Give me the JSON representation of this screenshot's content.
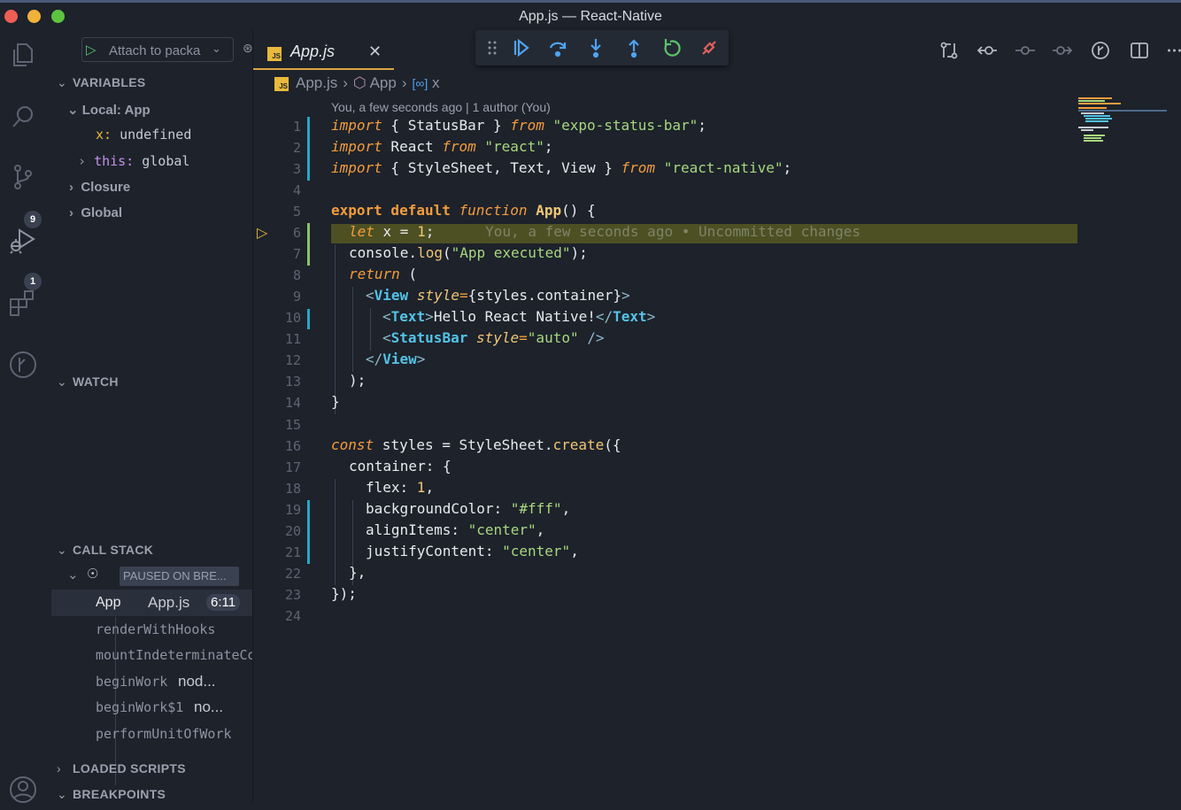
{
  "window": {
    "title": "App.js — React-Native",
    "controls": {
      "close_color": "#ee5e55",
      "minimize_color": "#f1b23a",
      "maximize_color": "#5dc440"
    }
  },
  "activity_bar": {
    "items": [
      {
        "icon": "files-icon"
      },
      {
        "icon": "search-icon"
      },
      {
        "icon": "source-control-icon",
        "badge": "9"
      },
      {
        "icon": "run-debug-icon",
        "badge": "1"
      },
      {
        "icon": "extensions-icon"
      },
      {
        "icon": "timeline-icon"
      },
      {
        "icon": "account-icon"
      }
    ]
  },
  "sidebar": {
    "debug_config": "Attach to packa",
    "variables": {
      "title": "VARIABLES",
      "local": "Local: App",
      "x_name": "x:",
      "x_value": "undefined",
      "this_name": "this:",
      "this_value": "global",
      "closure": "Closure",
      "global": "Global"
    },
    "watch": {
      "title": "WATCH"
    },
    "call_stack": {
      "title": "CALL STACK",
      "paused_label": "PAUSED ON BRE...",
      "frames": [
        {
          "fn": "App",
          "file": "App.js",
          "line": "6:11"
        },
        {
          "fn": "renderWithHooks",
          "file": ""
        },
        {
          "fn": "mountIndeterminateCo",
          "file": ""
        },
        {
          "fn": "beginWork",
          "file": "nod..."
        },
        {
          "fn": "beginWork$1",
          "file": "no..."
        },
        {
          "fn": "performUnitOfWork",
          "file": ""
        }
      ]
    },
    "loaded_scripts": "LOADED SCRIPTS",
    "breakpoints": "BREAKPOINTS"
  },
  "editor": {
    "tab": {
      "label": "App.js",
      "icon_text": "JS"
    },
    "breadcrumb": {
      "file": "App.js",
      "symbol": "App",
      "variable": "x"
    },
    "blame": "You, a few seconds ago | 1 author (You)",
    "inline_blame": "You, a few seconds ago • Uncommitted changes",
    "line_numbers": [
      "1",
      "2",
      "3",
      "4",
      "5",
      "6",
      "7",
      "8",
      "9",
      "10",
      "11",
      "12",
      "13",
      "14",
      "15",
      "16",
      "17",
      "18",
      "19",
      "20",
      "21",
      "22",
      "23",
      "24"
    ],
    "code": {
      "l1": [
        "import",
        " { StatusBar } ",
        "from",
        " ",
        "\"expo-status-bar\"",
        ";"
      ],
      "l2": [
        "import",
        " React ",
        "from",
        " ",
        "\"react\"",
        ";"
      ],
      "l3": [
        "import",
        " { StyleSheet, Text, View } ",
        "from",
        " ",
        "\"react-native\"",
        ";"
      ],
      "l5": [
        "export default",
        " ",
        "function",
        " ",
        "App",
        "() {"
      ],
      "l6": [
        "let",
        " x = ",
        "1",
        ";"
      ],
      "l7": [
        "console.",
        "log",
        "(",
        "\"App executed\"",
        ");"
      ],
      "l8": [
        "return",
        " ("
      ],
      "l9": [
        "<",
        "View",
        " ",
        "style",
        "=",
        "{styles.container}",
        ">"
      ],
      "l10": [
        "<",
        "Text",
        ">",
        "Hello React Native!",
        "</",
        "Text",
        ">"
      ],
      "l11": [
        "<",
        "StatusBar",
        " ",
        "style",
        "=",
        "\"auto\"",
        " />"
      ],
      "l12": [
        "</",
        "View",
        ">"
      ],
      "l13": [
        ");"
      ],
      "l14": [
        "}"
      ],
      "l16": [
        "const",
        " styles = StyleSheet.",
        "create",
        "({"
      ],
      "l17": [
        "container: {"
      ],
      "l18": [
        "flex: ",
        "1",
        ","
      ],
      "l19": [
        "backgroundColor: ",
        "\"#fff\"",
        ","
      ],
      "l20": [
        "alignItems: ",
        "\"center\"",
        ","
      ],
      "l21": [
        "justifyContent: ",
        "\"center\"",
        ","
      ],
      "l22": [
        "},"
      ],
      "l23": [
        "});"
      ]
    }
  },
  "debug_toolbar": {
    "buttons": [
      "drag-handle-icon",
      "continue-icon",
      "step-over-icon",
      "step-into-icon",
      "step-out-icon",
      "restart-icon",
      "disconnect-icon"
    ]
  },
  "editor_actions": [
    "open-changes-icon",
    "go-back-icon",
    "commit-icon",
    "go-forward-icon",
    "gitlens-icon",
    "split-editor-icon",
    "more-actions-icon"
  ]
}
